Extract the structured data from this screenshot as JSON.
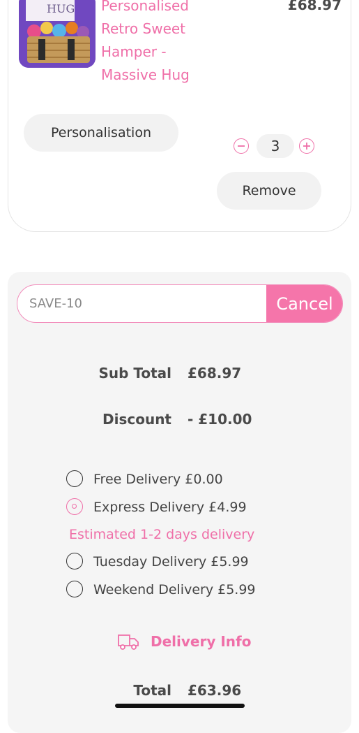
{
  "product": {
    "name_lines": [
      "Personalised",
      "Retro Sweet",
      "Hamper -",
      "Massive Hug"
    ],
    "price": "£68.97",
    "personalisation_label": "Personalisation",
    "quantity": "3",
    "remove_label": "Remove",
    "image_text": "HUG"
  },
  "promo": {
    "code_value": "SAVE-10",
    "cancel_label": "Cancel"
  },
  "summary": {
    "subtotal_label": "Sub Total",
    "subtotal_value": "£68.97",
    "discount_label": "Discount",
    "discount_value": "- £10.00"
  },
  "delivery": {
    "options": [
      {
        "label": "Free Delivery £0.00",
        "selected": false
      },
      {
        "label": "Express Delivery £4.99",
        "selected": true
      },
      {
        "label": "Tuesday Delivery £5.99",
        "selected": false
      },
      {
        "label": "Weekend Delivery £5.99",
        "selected": false
      }
    ],
    "estimate": "Estimated 1-2 days delivery",
    "info_label": "Delivery Info"
  },
  "total": {
    "label": "Total",
    "value": "£63.96"
  },
  "colors": {
    "accent": "#ef6fa8",
    "cancel_bg": "#f575aa",
    "panel_bg": "#f5f5f5"
  }
}
